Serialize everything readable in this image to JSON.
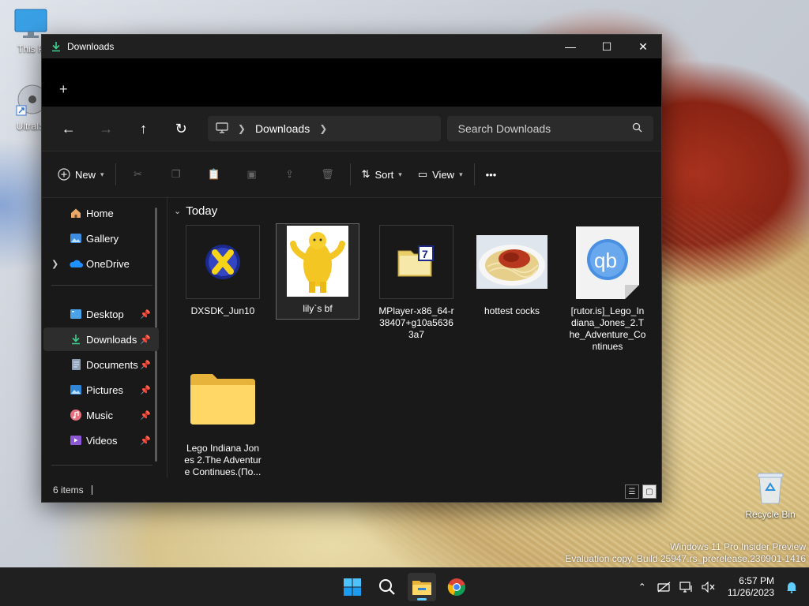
{
  "desktop": {
    "icons": [
      {
        "label": "This P"
      },
      {
        "label": "UltraIS"
      },
      {
        "label": "Recycle Bin"
      }
    ],
    "watermark": {
      "line1": "Windows 11 Pro Insider Preview",
      "line2": "Evaluation copy. Build 25947.rs_prerelease.230901-1416"
    }
  },
  "window": {
    "title": "Downloads",
    "controls": {
      "minimize": "—",
      "maximize": "☐",
      "close": "✕"
    },
    "new_tab": "+"
  },
  "navigation": {
    "back": "←",
    "forward": "→",
    "up": "↑",
    "refresh": "↻",
    "breadcrumb": [
      "Downloads"
    ],
    "search_placeholder": "Search Downloads"
  },
  "command_bar": {
    "new_label": "New",
    "sort_label": "Sort",
    "view_label": "View",
    "more_label": "•••"
  },
  "sidebar": {
    "items": [
      {
        "label": "Home",
        "icon": "home-icon",
        "pinned": false
      },
      {
        "label": "Gallery",
        "icon": "gallery-icon",
        "pinned": false
      },
      {
        "label": "OneDrive",
        "icon": "onedrive-icon",
        "pinned": false,
        "expandable": true
      },
      {
        "label": "Desktop",
        "icon": "desktop-folder-icon",
        "pinned": true
      },
      {
        "label": "Downloads",
        "icon": "downloads-folder-icon",
        "pinned": true,
        "selected": true
      },
      {
        "label": "Documents",
        "icon": "documents-folder-icon",
        "pinned": true
      },
      {
        "label": "Pictures",
        "icon": "pictures-folder-icon",
        "pinned": true
      },
      {
        "label": "Music",
        "icon": "music-folder-icon",
        "pinned": true
      },
      {
        "label": "Videos",
        "icon": "videos-folder-icon",
        "pinned": true
      }
    ]
  },
  "content": {
    "group_label": "Today",
    "files": [
      {
        "name": "DXSDK_Jun10",
        "icon": "directx-icon"
      },
      {
        "name": "lily`s bf",
        "icon": "image-thumbnail",
        "selected": true
      },
      {
        "name": "MPlayer-x86_64-r38407+g10a56363a7",
        "icon": "archive-icon"
      },
      {
        "name": "hottest cocks",
        "icon": "spaghetti-thumbnail"
      },
      {
        "name": "[rutor.is]_Lego_Indiana_Jones_2.The_Adventure_Continues",
        "icon": "qbittorrent-icon"
      },
      {
        "name": "Lego Indiana Jones 2.The Adventure Continues.(По...",
        "icon": "folder-icon"
      }
    ]
  },
  "status": {
    "item_count": "6 items"
  },
  "taskbar": {
    "time": "6:57 PM",
    "date": "11/26/2023"
  }
}
